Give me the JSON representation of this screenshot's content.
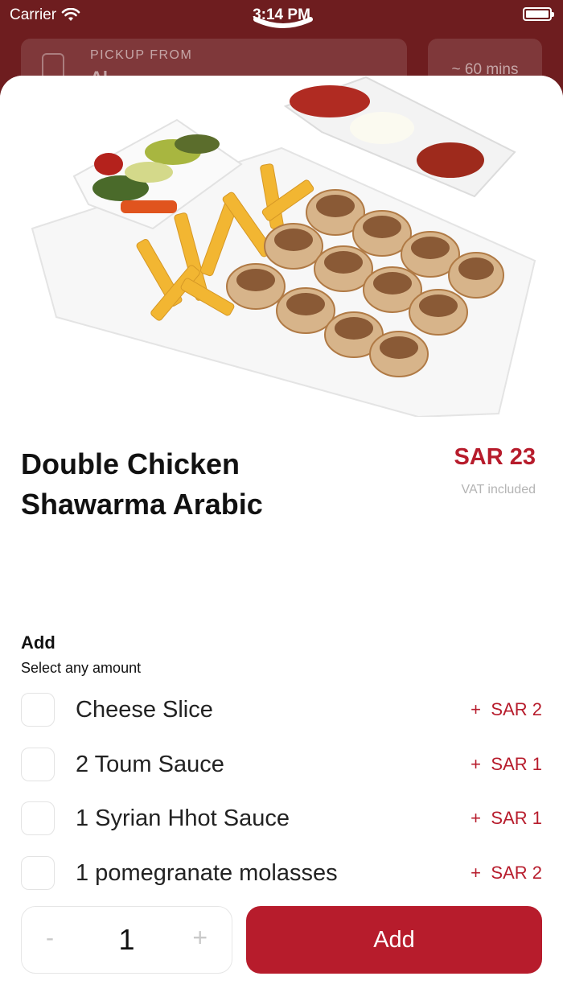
{
  "status_bar": {
    "carrier": "Carrier",
    "time": "3:14 PM"
  },
  "background": {
    "pickup_label": "PICKUP FROM",
    "pickup_name": "Al...",
    "eta": "~ 60 mins"
  },
  "product": {
    "title": "Double Chicken Shawarma Arabic",
    "price": "SAR 23",
    "vat_note": "VAT included"
  },
  "addons": {
    "title": "Add",
    "subtitle": "Select any amount",
    "options": [
      {
        "label": "Cheese Slice",
        "plus": "+",
        "price": "SAR 2"
      },
      {
        "label": "2 Toum Sauce",
        "plus": "+",
        "price": "SAR 1"
      },
      {
        "label": "1 Syrian Hhot Sauce",
        "plus": "+",
        "price": "SAR 1"
      },
      {
        "label": "1 pomegranate molasses",
        "plus": "+",
        "price": "SAR 2"
      }
    ]
  },
  "footer": {
    "minus": "-",
    "quantity": "1",
    "plus": "+",
    "add_label": "Add"
  },
  "colors": {
    "brand": "#b71c2c",
    "background": "#6e1d1f"
  }
}
